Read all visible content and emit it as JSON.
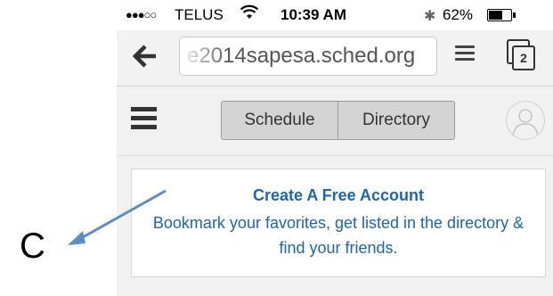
{
  "status_bar": {
    "signal": "●●●○○",
    "carrier": "TELUS",
    "wifi_icon": "wifi-icon",
    "time": "10:39 AM",
    "bluetooth_icon": "bluetooth-icon",
    "battery_percent": "62%",
    "battery_level": 0.62
  },
  "browser": {
    "url": "e2014sapesa.sched.org",
    "tab_count": "2",
    "back_icon": "back-arrow-icon",
    "reader_icon": "reader-menu-icon",
    "tabs_icon": "tabs-icon"
  },
  "site_header": {
    "menu_icon": "hamburger-icon",
    "tabs": [
      {
        "label": "Schedule"
      },
      {
        "label": "Directory"
      }
    ],
    "profile_icon": "user-profile-icon"
  },
  "banner": {
    "title": "Create A Free Account",
    "text": "Bookmark your favorites, get listed in the directory & find your friends."
  },
  "annotation": {
    "letter": "C",
    "arrow_color": "#5b8ec9"
  },
  "colors": {
    "link_blue": "#1f66a8",
    "header_bg": "#f1f1f1"
  }
}
